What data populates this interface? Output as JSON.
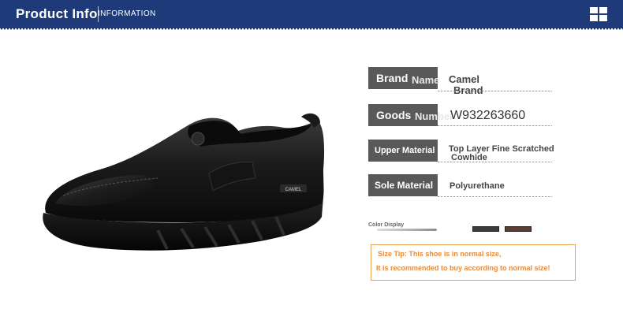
{
  "header": {
    "title": "Product Info",
    "subtitle": "INFORMATION"
  },
  "specs": [
    {
      "label": "Brand",
      "label_ext": "Name",
      "value_line1": "Camel",
      "value_line2": "Brand"
    },
    {
      "label": "Goods",
      "label_ext": "Number",
      "value_line1": "W932263660"
    },
    {
      "label": "Upper Material",
      "value_line1": "Top Layer Fine Scratched",
      "value_line2": "Cowhide"
    },
    {
      "label": "Sole Material",
      "value_line1": "Polyurethane"
    }
  ],
  "color_display": {
    "label": "Color Display",
    "swatches": [
      "#3c3c3c",
      "#5a3d33"
    ]
  },
  "size_tip": {
    "line1": "Size Tip: This shoe is in normal size,",
    "line2": "It is recommended to buy according to normal size!"
  },
  "product": {
    "heel_label": "CAMEL"
  },
  "colors": {
    "header_bg": "#1f3a78",
    "label_bg": "#595959",
    "tip_color": "#e88a3a"
  }
}
